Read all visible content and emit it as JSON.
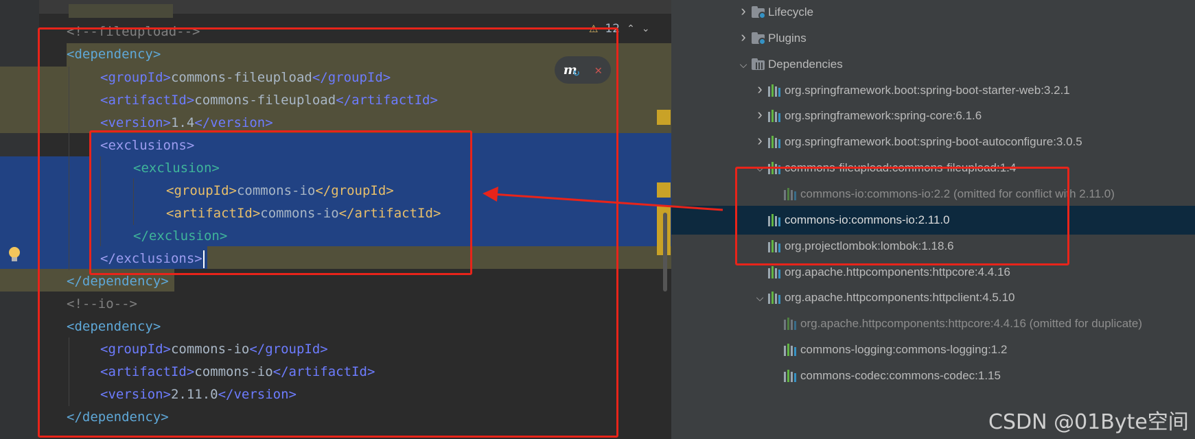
{
  "editor": {
    "lines": [
      {
        "id": "l0",
        "parts": [
          [
            "comment",
            "<!--fileupload-->"
          ]
        ]
      },
      {
        "id": "l1",
        "parts": [
          [
            "tag-blue",
            "<dependency>"
          ]
        ]
      },
      {
        "id": "l2",
        "parts": [
          [
            "tag-blue2",
            "<groupId>"
          ],
          [
            "txt",
            "commons-fileupload"
          ],
          [
            "tag-blue2",
            "</groupId>"
          ]
        ]
      },
      {
        "id": "l3",
        "parts": [
          [
            "tag-blue2",
            "<artifactId>"
          ],
          [
            "txt",
            "commons-fileupload"
          ],
          [
            "tag-blue2",
            "</artifactId>"
          ]
        ]
      },
      {
        "id": "l4",
        "parts": [
          [
            "tag-blue2",
            "<version>"
          ],
          [
            "txt",
            "1.4"
          ],
          [
            "tag-blue2",
            "</version>"
          ]
        ]
      },
      {
        "id": "l5",
        "parts": [
          [
            "tag-child",
            "<exclusions>"
          ]
        ]
      },
      {
        "id": "l6",
        "parts": [
          [
            "tag-excl",
            "<exclusion>"
          ]
        ]
      },
      {
        "id": "l7",
        "parts": [
          [
            "tag-inner",
            "<groupId>"
          ],
          [
            "txt",
            "commons-io"
          ],
          [
            "tag-inner",
            "</groupId>"
          ]
        ]
      },
      {
        "id": "l8",
        "parts": [
          [
            "tag-inner",
            "<artifactId>"
          ],
          [
            "txt",
            "commons-io"
          ],
          [
            "tag-inner",
            "</artifactId>"
          ]
        ]
      },
      {
        "id": "l9",
        "parts": [
          [
            "tag-excl",
            "</exclusion>"
          ]
        ]
      },
      {
        "id": "l10",
        "parts": [
          [
            "tag-child",
            "</exclusions>"
          ]
        ]
      },
      {
        "id": "l11",
        "parts": [
          [
            "tag-blue",
            "</dependency>"
          ]
        ]
      },
      {
        "id": "l12",
        "parts": [
          [
            "comment",
            "<!--io-->"
          ]
        ]
      },
      {
        "id": "l13",
        "parts": [
          [
            "tag-blue",
            "<dependency>"
          ]
        ]
      },
      {
        "id": "l14",
        "parts": [
          [
            "tag-blue2",
            "<groupId>"
          ],
          [
            "txt",
            "commons-io"
          ],
          [
            "tag-blue2",
            "</groupId>"
          ]
        ]
      },
      {
        "id": "l15",
        "parts": [
          [
            "tag-blue2",
            "<artifactId>"
          ],
          [
            "txt",
            "commons-io"
          ],
          [
            "tag-blue2",
            "</artifactId>"
          ]
        ]
      },
      {
        "id": "l16",
        "parts": [
          [
            "tag-blue2",
            "<version>"
          ],
          [
            "txt",
            "2.11.0"
          ],
          [
            "tag-blue2",
            "</version>"
          ]
        ]
      },
      {
        "id": "l17",
        "parts": [
          [
            "tag-blue",
            "</dependency>"
          ]
        ]
      }
    ],
    "inspection": {
      "warning_count": "12",
      "warning_icon": "warning-triangle-icon"
    },
    "maven_reload": {
      "icon": "maven-reload-icon",
      "close_icon": "close-icon"
    }
  },
  "maven_tree": {
    "rows": [
      {
        "label": "Lifecycle",
        "icon": "folder-gear-icon",
        "expander": "collapsed",
        "level": 0
      },
      {
        "label": "Plugins",
        "icon": "folder-gear-icon",
        "expander": "collapsed",
        "level": 0
      },
      {
        "label": "Dependencies",
        "icon": "dependencies-folder-icon",
        "expander": "expanded",
        "level": 0
      },
      {
        "label": "org.springframework.boot:spring-boot-starter-web:3.2.1",
        "icon": "library-icon",
        "expander": "collapsed",
        "level": 1
      },
      {
        "label": "org.springframework:spring-core:6.1.6",
        "icon": "library-icon",
        "expander": "collapsed",
        "level": 1
      },
      {
        "label": "org.springframework.boot:spring-boot-autoconfigure:3.0.5",
        "icon": "library-icon",
        "expander": "collapsed",
        "level": 1
      },
      {
        "label": "commons-fileupload:commons-fileupload:1.4",
        "icon": "library-icon",
        "expander": "expanded",
        "level": 1
      },
      {
        "label": "commons-io:commons-io:2.2 (omitted for conflict with 2.11.0)",
        "icon": "library-icon",
        "expander": "none",
        "level": 2,
        "omitted": true
      },
      {
        "label": "commons-io:commons-io:2.11.0",
        "icon": "library-icon",
        "expander": "none",
        "level": 1,
        "selected": true
      },
      {
        "label": "org.projectlombok:lombok:1.18.6",
        "icon": "library-icon",
        "expander": "none",
        "level": 1
      },
      {
        "label": "org.apache.httpcomponents:httpcore:4.4.16",
        "icon": "library-icon",
        "expander": "none",
        "level": 1
      },
      {
        "label": "org.apache.httpcomponents:httpclient:4.5.10",
        "icon": "library-icon",
        "expander": "expanded",
        "level": 1
      },
      {
        "label": "org.apache.httpcomponents:httpcore:4.4.16 (omitted for duplicate)",
        "icon": "library-icon",
        "expander": "none",
        "level": 2,
        "omitted": true
      },
      {
        "label": "commons-logging:commons-logging:1.2",
        "icon": "library-icon",
        "expander": "none",
        "level": 2
      },
      {
        "label": "commons-codec:commons-codec:1.15",
        "icon": "library-icon",
        "expander": "none",
        "level": 2
      }
    ]
  },
  "watermark": "CSDN @01Byte空间",
  "colors": {
    "annotation_red": "#e8241a",
    "selection_blue": "#214283",
    "selected_row": "#0d293e"
  }
}
